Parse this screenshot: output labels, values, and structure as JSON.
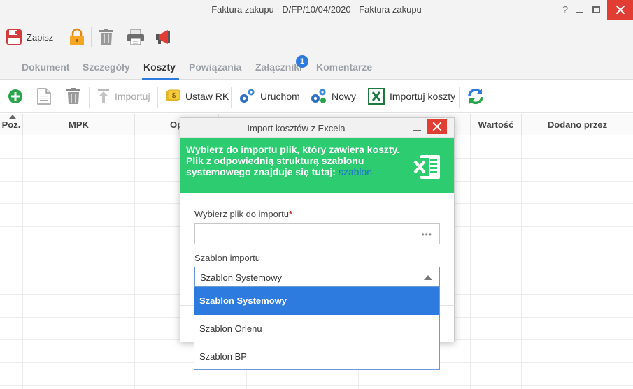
{
  "window": {
    "title": "Faktura zakupu - D/FP/10/04/2020 - Faktura zakupu",
    "help_label": "?"
  },
  "toolbar": {
    "save_label": "Zapisz"
  },
  "tabs": [
    {
      "label": "Dokument",
      "active": false
    },
    {
      "label": "Szczegóły",
      "active": false
    },
    {
      "label": "Koszty",
      "active": true
    },
    {
      "label": "Powiązania",
      "active": false
    },
    {
      "label": "Załączniki",
      "active": false,
      "badge": "1"
    },
    {
      "label": "Komentarze",
      "active": false
    }
  ],
  "subtoolbar": {
    "import_label": "Importuj",
    "set_rk_label": "Ustaw RK",
    "run_label": "Uruchom",
    "new_label": "Nowy",
    "import_costs_label": "Importuj koszty"
  },
  "grid": {
    "columns": [
      "Poz.",
      "MPK",
      "Op",
      "Wartość",
      "Dodano przez"
    ]
  },
  "modal": {
    "title": "Import kosztów z Excela",
    "banner_text": "Wybierz do importu plik, który zawiera koszty. Plik z odpowiednią strukturą szablonu systemowego znajduje się tutaj:",
    "banner_link": "szablon",
    "file_label": "Wybierz plik do importu",
    "file_value": "",
    "file_browse": "•••",
    "template_label": "Szablon importu",
    "template_value": "Szablon Systemowy",
    "template_options": [
      "Szablon Systemowy",
      "Szablon Orlenu",
      "Szablon BP"
    ]
  },
  "colors": {
    "accent_blue": "#2e7be0",
    "banner_green": "#2ecc71",
    "close_red": "#e23d33"
  }
}
